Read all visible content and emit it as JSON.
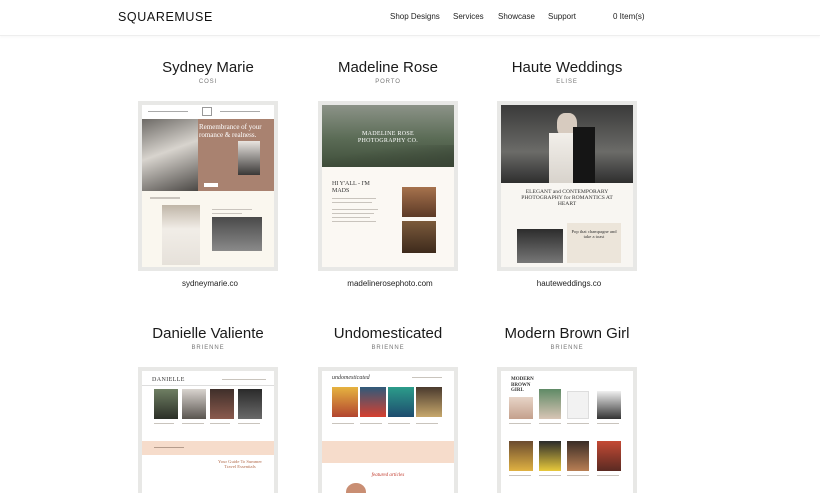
{
  "brand": {
    "logo": "SQUAREMUSE"
  },
  "nav": {
    "items": [
      "Shop Designs",
      "Services",
      "Showcase",
      "Support"
    ],
    "cart": "0 Item(s)"
  },
  "showcase": [
    {
      "title": "Sydney Marie",
      "theme": "COSI",
      "url": "sydneymarie.co",
      "thumb_text": {
        "headline": "Remembrance of your romance & realness."
      }
    },
    {
      "title": "Madeline Rose",
      "theme": "PORTO",
      "url": "madelinerosephoto.com",
      "thumb_text": {
        "headline": "MADELINE ROSE PHOTOGRAPHY CO.",
        "intro": "HI Y'ALL - I'M MADS"
      }
    },
    {
      "title": "Haute Weddings",
      "theme": "ELISE",
      "url": "hauteweddings.co",
      "thumb_text": {
        "headline": "ELEGANT and CONTEMPORARY PHOTOGRAPHY for ROMANTICS AT HEART",
        "aside": "Pop that champagne and take a toast"
      }
    },
    {
      "title": "Danielle Valiente",
      "theme": "BRIENNE",
      "url": "",
      "thumb_text": {
        "masthead": "DANIELLE",
        "aside": "Your Guide To Summer Travel Essentials"
      }
    },
    {
      "title": "Undomesticated",
      "theme": "BRIENNE",
      "url": "",
      "thumb_text": {
        "masthead": "undomesticated",
        "aside": "featured articles"
      }
    },
    {
      "title": "Modern Brown Girl",
      "theme": "BRIENNE",
      "url": "",
      "thumb_text": {
        "masthead": "MODERN BROWN GIRL"
      }
    }
  ]
}
